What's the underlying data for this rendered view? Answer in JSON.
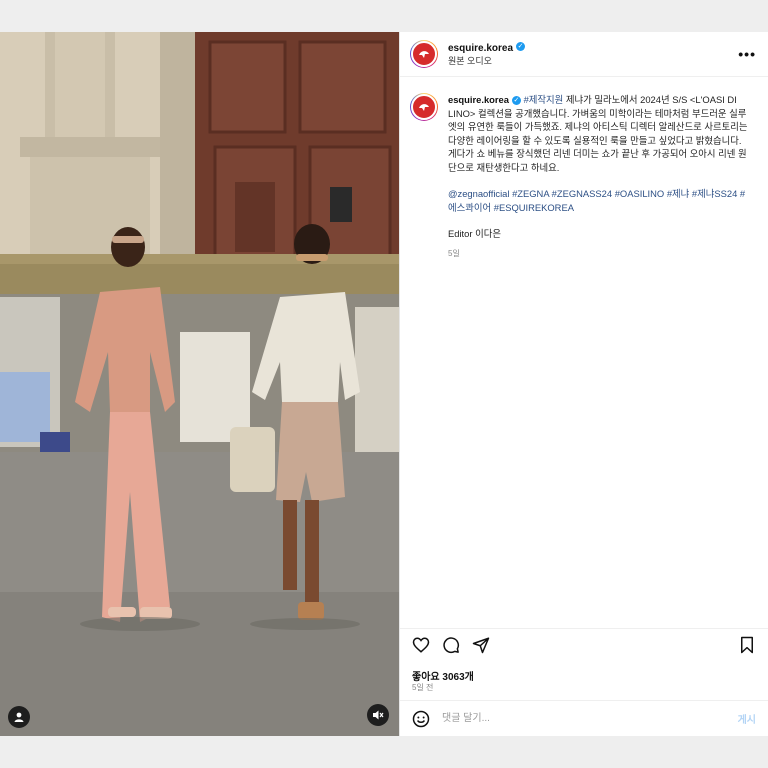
{
  "account": {
    "username": "esquire.korea",
    "audio_label": "원본 오디오"
  },
  "caption": {
    "username": "esquire.korea",
    "hashtag_sponsored": "#제작지원",
    "text": "제냐가 밀라노에서 2024년 S/S <L'OASI DI LINO> 컬렉션을 공개했습니다. 가벼움의 미학이라는 테마처럼 부드러운 실루엣의 유연한 룩들이 가득했죠. 제냐의 아티스틱 디렉터 알레산드로 사르토리는 다양한 레이어링을 할 수 있도록 실용적인 룩을 만들고 싶었다고 밝혔습니다. 게다가 쇼 베뉴를 장식했던 리넨 더미는 쇼가 끝난 후 가공되어 오아시 리넨 원단으로 재탄생한다고 하네요.",
    "tags": "@zegnaofficial #ZEGNA #ZEGNASS24 #OASILINO #제냐 #제냐SS24 #에스콰이어 #ESQUIREKOREA",
    "editor_label": "Editor",
    "editor_name": "이다은",
    "time_ago": "5일"
  },
  "stats": {
    "likes": "좋아요 3063개",
    "posted": "5일 전"
  },
  "comment": {
    "placeholder": "댓글 달기...",
    "post_label": "게시"
  },
  "icons": [
    "more-icon",
    "heart-icon",
    "comment-icon",
    "share-icon",
    "bookmark-icon",
    "emoji-icon",
    "user-tag-icon",
    "audio-icon",
    "verified-icon"
  ],
  "colors": {
    "verified": "#1d9bf0",
    "hashtag": "#2c4f85",
    "post_button": "#b3d4f5"
  }
}
